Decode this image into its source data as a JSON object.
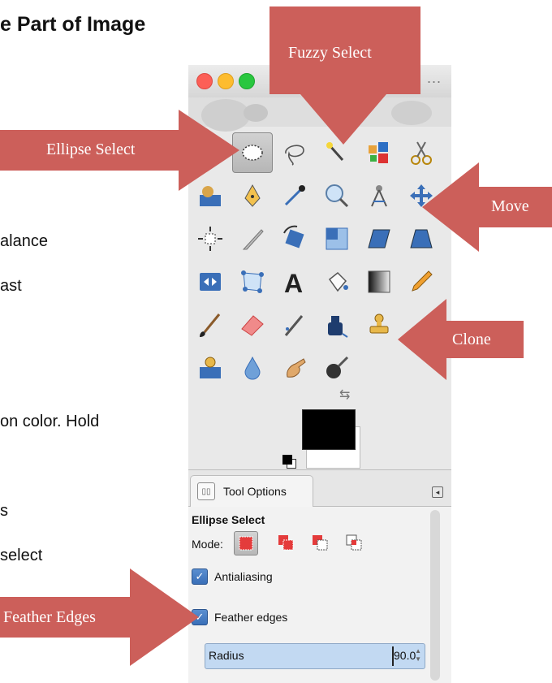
{
  "document": {
    "title": "e Part of Image",
    "lines": [
      "alance",
      "ast",
      "on color. Hold",
      "s",
      "select"
    ]
  },
  "window": {
    "ellipsis": "..."
  },
  "toolbox": {
    "tools": [
      [
        "rect-select",
        "ellipse-select",
        "free-select",
        "fuzzy-select",
        "select-by-color",
        "scissors-select"
      ],
      [
        "foreground-select",
        "paths",
        "color-picker",
        "zoom",
        "measure",
        "move"
      ],
      [
        "align",
        "crop",
        "rotate",
        "scale",
        "shear",
        "perspective"
      ],
      [
        "flip",
        "cage-transform",
        "text",
        "bucket-fill",
        "blend",
        "pencil"
      ],
      [
        "paintbrush",
        "eraser",
        "airbrush",
        "ink",
        "clone"
      ],
      [
        "heal",
        "blur",
        "smudge",
        "dodge-burn"
      ]
    ],
    "active_tool": "ellipse-select",
    "colors": {
      "foreground": "#000000",
      "background": "#ffffff"
    }
  },
  "tool_options": {
    "tab_label": "Tool Options",
    "title": "Ellipse Select",
    "mode_label": "Mode:",
    "modes": [
      "replace",
      "add",
      "subtract",
      "intersect"
    ],
    "antialiasing": {
      "label": "Antialiasing",
      "checked": true
    },
    "feather": {
      "label": "Feather edges",
      "checked": true
    },
    "radius": {
      "label": "Radius",
      "value": "90.0"
    }
  },
  "callouts": {
    "fuzzy": "Fuzzy Select",
    "ellipse": "Ellipse Select",
    "move": "Move",
    "clone": "Clone",
    "feather": "Feather Edges"
  },
  "colors": {
    "callout": "#cc5f5a",
    "accent": "#3a6fb8"
  }
}
